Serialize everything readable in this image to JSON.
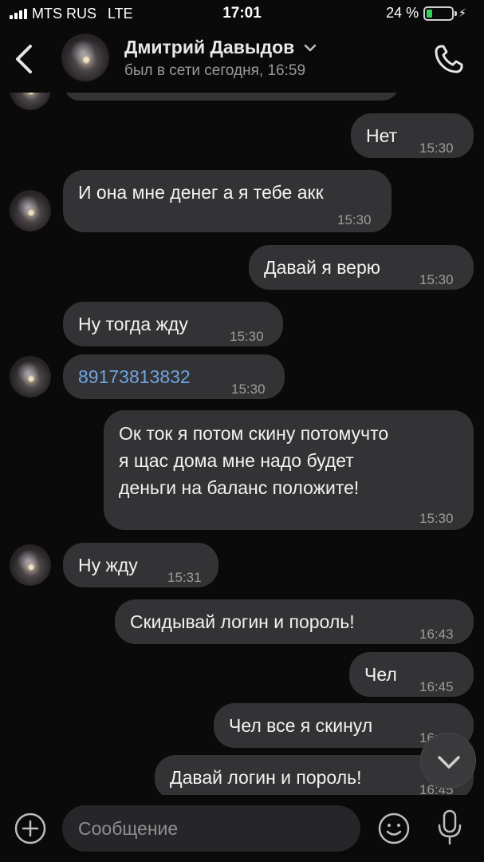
{
  "status_bar": {
    "carrier": "MTS RUS",
    "network": "LTE",
    "time": "17:01",
    "battery": "24 %",
    "battery_level": 0.24,
    "battery_color": "#37d25a"
  },
  "header": {
    "name": "Дмитрий Давыдов",
    "status": "был в сети сегодня, 16:59"
  },
  "messages": [
    {
      "text": "Нет",
      "time": "15:30"
    },
    {
      "text": "И она мне денег а я тебе акк",
      "time": "15:30"
    },
    {
      "text": "Давай я верю",
      "time": "15:30"
    },
    {
      "text": "Ну тогда жду",
      "time": "15:30"
    },
    {
      "text": "89173813832",
      "time": "15:30"
    },
    {
      "text_lines": [
        "Ок ток я потом скину потомучто",
        "я щас дома мне надо будет",
        "деньги на баланс положите!"
      ],
      "time": "15:30"
    },
    {
      "text": "Ну жду",
      "time": "15:31"
    },
    {
      "text": "Скидывай логин и пороль!",
      "time": "16:43"
    },
    {
      "text": "Чел",
      "time": "16:45"
    },
    {
      "text": "Чел все я скинул",
      "time": "16:45"
    },
    {
      "text": "Давай логин и пороль!",
      "time": "16:45"
    }
  ],
  "composer": {
    "placeholder": "Сообщение"
  },
  "icons": {
    "back": "chevron-left-icon",
    "call": "phone-icon",
    "add": "plus-circle-icon",
    "emoji": "smiley-icon",
    "mic": "microphone-icon",
    "scroll": "chevron-down-icon"
  },
  "colors": {
    "bubble": "#333335",
    "background": "#0a0a0a",
    "link": "#6fa3e0"
  }
}
